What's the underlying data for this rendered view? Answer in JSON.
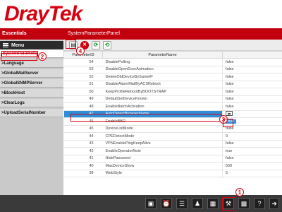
{
  "header": {
    "logo_text": "DrayTek"
  },
  "sidebar": {
    "section_title": "Essentials",
    "menu_label": "Menu",
    "items": [
      {
        "label": "SystemParamete",
        "active": true
      },
      {
        "label": ">Language"
      },
      {
        "label": ">GlobalMailServer"
      },
      {
        "label": ">GlobalSNMPServer"
      },
      {
        "label": ">BlockHost"
      },
      {
        "label": ">ClearLogs"
      },
      {
        "label": ">UploadSerialNumber"
      }
    ]
  },
  "panel": {
    "title": "SystemParameterPanel",
    "columns": [
      "ParameterID",
      "ParameterName",
      ""
    ],
    "rows": [
      {
        "id": "54",
        "name": "DisablePolling",
        "value": "false"
      },
      {
        "id": "53",
        "name": "DisableOpenDoorAnimation",
        "value": "false"
      },
      {
        "id": "52",
        "name": "DeleteOldDeviceBySameIP",
        "value": "false"
      },
      {
        "id": "51",
        "name": "DisableAlarmMailByACSReboot",
        "value": "false"
      },
      {
        "id": "50",
        "name": "KeepProfileRebootByBOOTSTRAP",
        "value": "false"
      },
      {
        "id": "49",
        "name": "DefaultSetDeviceKnown",
        "value": "false"
      },
      {
        "id": "48",
        "name": "EnableBatchActivation",
        "value": "false"
      },
      {
        "id": "47",
        "name": "AutoDetectBrowserName",
        "value": ""
      },
      {
        "id": "46",
        "name": "EnableBBD",
        "value": "true"
      },
      {
        "id": "45",
        "name": "DeviceListMode",
        "value": "false"
      },
      {
        "id": "44",
        "name": "CPEDetectMode",
        "value": "0"
      },
      {
        "id": "43",
        "name": "VPNEnablePingKeepAlive",
        "value": "false"
      },
      {
        "id": "42",
        "name": "EnableOperatorNote",
        "value": "true"
      },
      {
        "id": "41",
        "name": "HidePassword",
        "value": "false"
      },
      {
        "id": "40",
        "name": "MaxDeviceShow",
        "value": "500"
      },
      {
        "id": "39",
        "name": "WebStyle",
        "value": "5"
      }
    ]
  },
  "callouts": {
    "c1": "1",
    "c2": "2",
    "c3": "3",
    "c4": "4"
  },
  "colors": {
    "brand_red": "#d7000f",
    "selection_blue": "#2e8fd9"
  }
}
